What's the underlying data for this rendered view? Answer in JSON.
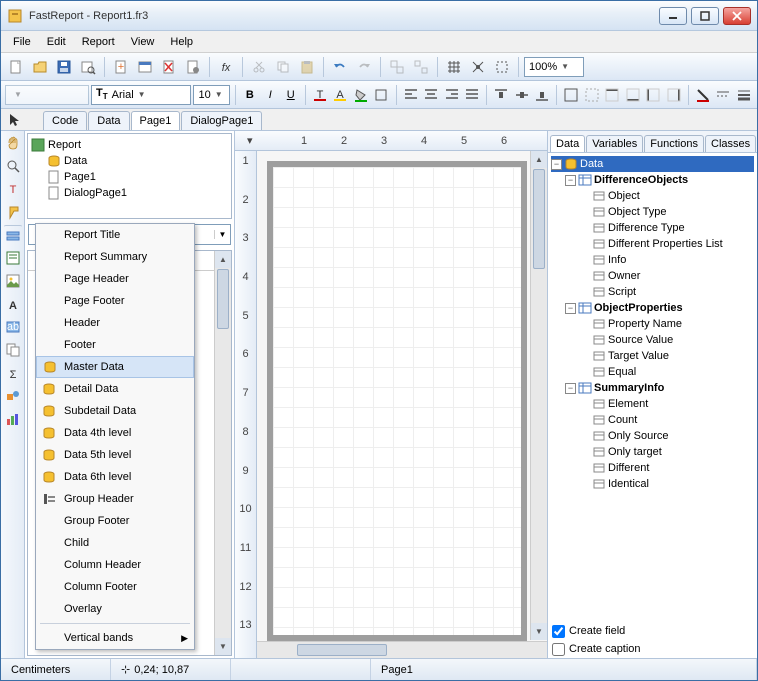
{
  "window": {
    "title": "FastReport - Report1.fr3"
  },
  "menu": {
    "file": "File",
    "edit": "Edit",
    "report": "Report",
    "view": "View",
    "help": "Help"
  },
  "toolbar": {
    "zoom": "100%",
    "font_name": "Arial",
    "font_size": "10"
  },
  "doc_tabs": {
    "code": "Code",
    "data": "Data",
    "page1": "Page1",
    "dialog1": "DialogPage1"
  },
  "tree": {
    "root": "Report",
    "items": [
      "Data",
      "Page1",
      "DialogPage1"
    ]
  },
  "context_menu": {
    "items": [
      "Report Title",
      "Report Summary",
      "Page Header",
      "Page Footer",
      "Header",
      "Footer",
      "Master Data",
      "Detail Data",
      "Subdetail Data",
      "Data 4th level",
      "Data 5th level",
      "Data 6th level",
      "Group Header",
      "Group Footer",
      "Child",
      "Column Header",
      "Column Footer",
      "Overlay"
    ],
    "sub": "Vertical bands",
    "highlighted_index": 6
  },
  "right_tabs": {
    "data": "Data",
    "vars": "Variables",
    "funcs": "Functions",
    "classes": "Classes"
  },
  "data_tree": {
    "root": "Data",
    "groups": [
      {
        "name": "DifferenceObjects",
        "fields": [
          "Object",
          "Object Type",
          "Difference Type",
          "Different Properties List",
          "Info",
          "Owner",
          "Script"
        ]
      },
      {
        "name": "ObjectProperties",
        "fields": [
          "Property Name",
          "Source Value",
          "Target Value",
          "Equal"
        ]
      },
      {
        "name": "SummaryInfo",
        "fields": [
          "Element",
          "Count",
          "Only Source",
          "Only target",
          "Different",
          "Identical"
        ]
      }
    ]
  },
  "checks": {
    "field": "Create field",
    "caption": "Create caption"
  },
  "status": {
    "units": "Centimeters",
    "pos": "0,24; 10,87",
    "page": "Page1"
  },
  "ruler_h": [
    "1",
    "2",
    "3",
    "4",
    "5",
    "6"
  ],
  "ruler_v": [
    "1",
    "2",
    "3",
    "4",
    "5",
    "6",
    "7",
    "8",
    "9",
    "10",
    "11",
    "12",
    "13"
  ]
}
